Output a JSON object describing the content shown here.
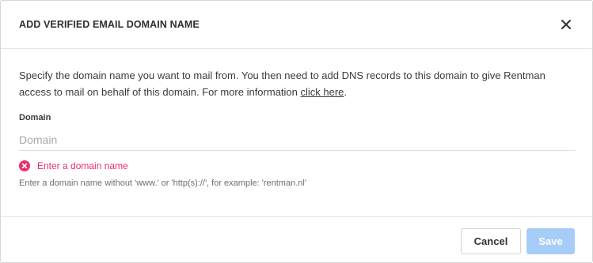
{
  "dialog": {
    "title": "ADD VERIFIED EMAIL DOMAIN NAME",
    "close_icon": "close-icon"
  },
  "body": {
    "description_text": "Specify the domain name you want to mail from. You then need to add DNS records to this domain to give Rentman access to mail on behalf of this domain. For more information ",
    "link_text": "click here",
    "description_end": "."
  },
  "field": {
    "label": "Domain",
    "placeholder": "Domain",
    "value": "",
    "error_icon": "error-circle-icon",
    "error_text": "Enter a domain name",
    "help_text": "Enter a domain name without 'www.' or 'http(s)://', for example: 'rentman.nl'"
  },
  "footer": {
    "cancel_label": "Cancel",
    "save_label": "Save"
  },
  "colors": {
    "error": "#e8306a",
    "save_disabled": "#a6cdf7"
  }
}
